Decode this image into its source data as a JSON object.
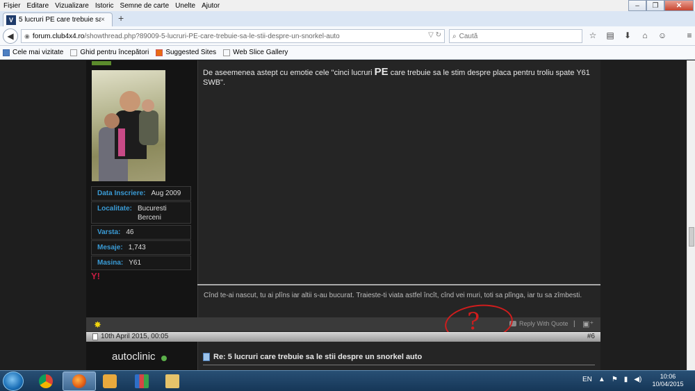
{
  "menu": [
    "Fișier",
    "Editare",
    "Vizualizare",
    "Istoric",
    "Semne de carte",
    "Unelte",
    "Ajutor"
  ],
  "tab": {
    "title": "5 lucruri PE care trebuie sa ...",
    "close": "×",
    "new": "+"
  },
  "url": {
    "domain": "forum.club4x4.ro",
    "path": "/showthread.php?89009-5-lucruri-PE-care-trebuie-sa-le-stii-despre-un-snorkel-auto"
  },
  "search": {
    "placeholder": "Caută"
  },
  "bookmarks": [
    "Cele mai vizitate",
    "Ghid pentru începători",
    "Suggested Sites",
    "Web Slice Gallery"
  ],
  "user1": {
    "info": [
      {
        "label": "Data Inscriere:",
        "value": "Aug 2009"
      },
      {
        "label": "Localitate:",
        "value": "Bucuresti Berceni"
      },
      {
        "label": "Varsta:",
        "value": "46"
      },
      {
        "label": "Mesaje:",
        "value": "1,743"
      },
      {
        "label": "Masina:",
        "value": "Y61"
      }
    ]
  },
  "post1": {
    "text_before": "De aseemenea astept cu emotie cele \"cinci lucruri ",
    "text_pe": "PE",
    "text_after": " care trebuie sa le stim despre placa pentru troliu spate Y61 SWB\".",
    "signature": "Cînd te-ai nascut, tu ai plîns iar altii s-au bucurat. Traieste-ti viata astfel încît, cînd vei muri, toti sa plînga, iar tu sa zîmbesti.",
    "reply_quote": "Reply With Quote",
    "annotation": "?"
  },
  "post2": {
    "date": "10th April 2015, 00:05",
    "number": "#6",
    "username": "autoclinic",
    "title": "Re: 5 lucruri care trebuie sa le stii despre un snorkel auto"
  },
  "taskbar": {
    "lang": "EN",
    "time": "10:06",
    "date": "10/04/2015"
  }
}
